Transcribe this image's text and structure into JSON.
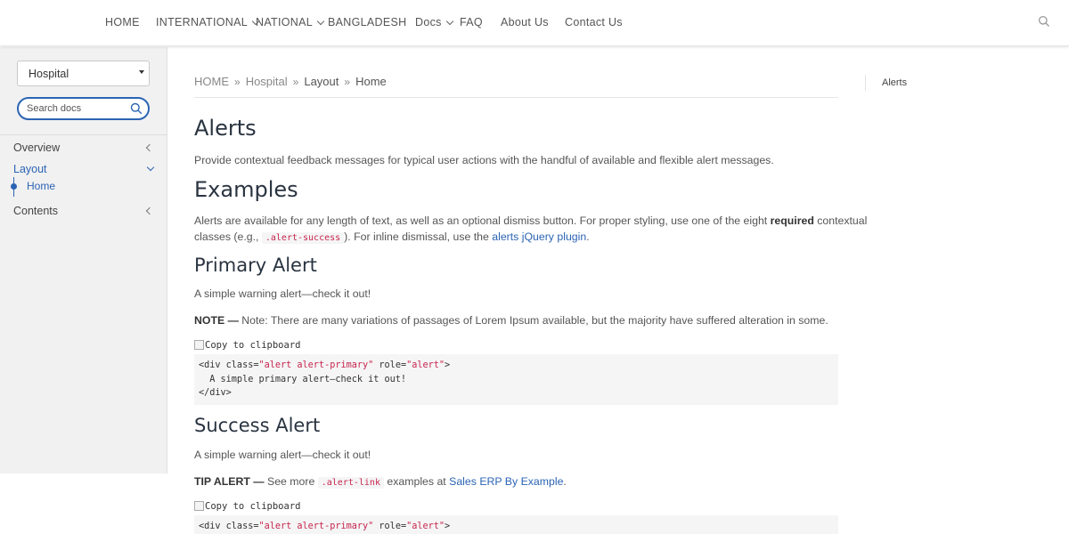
{
  "nav": {
    "items": [
      {
        "label": "HOME",
        "dropdown": false
      },
      {
        "label": "INTERNATIONAL",
        "dropdown": true
      },
      {
        "label": "NATIONAL",
        "dropdown": true
      },
      {
        "label": "BANGLADESH",
        "dropdown": false
      },
      {
        "label": "Docs",
        "dropdown": true
      },
      {
        "label": "FAQ",
        "dropdown": false
      },
      {
        "label": "About Us",
        "dropdown": false
      },
      {
        "label": "Contact Us",
        "dropdown": false
      }
    ],
    "search_icon": "search-icon"
  },
  "sidebar": {
    "select_value": "Hospital",
    "search_placeholder": "Search docs",
    "items": [
      {
        "label": "Overview",
        "expanded": false
      },
      {
        "label": "Layout",
        "expanded": true,
        "active": true
      },
      {
        "label": "Contents",
        "expanded": false
      }
    ],
    "sub_item": "Home"
  },
  "breadcrumb": {
    "items": [
      "HOME",
      "Hospital",
      "Layout",
      "Home"
    ],
    "separator": "»"
  },
  "content": {
    "title": "Alerts",
    "intro": "Provide contextual feedback messages for typical user actions with the handful of available and flexible alert messages.",
    "examples_heading": "Examples",
    "examples_text_1": "Alerts are available for any length of text, as well as an optional dismiss button. For proper styling, use one of the eight",
    "examples_bold": "required",
    "examples_text_2": "contextual",
    "examples_text_3": "classes (e.g.,",
    "examples_code": ".alert-success",
    "examples_text_4": "). For inline dismissal, use the",
    "examples_link": "alerts jQuery plugin",
    "examples_text_5": ".",
    "primary_heading": "Primary Alert",
    "primary_text": "A simple warning alert—check it out!",
    "note_label": "NOTE —",
    "note_text": "Note: There are many variations of passages of Lorem Ipsum available, but the majority have suffered alteration in some.",
    "copy_label": "Copy to clipboard",
    "code_line1_a": "<div class=",
    "code_line1_b": "\"alert alert-primary\"",
    "code_line1_c": " role=",
    "code_line1_d": "\"alert\"",
    "code_line1_e": ">",
    "code_line2": "  A simple primary alert—check it out!",
    "code_line3": "</div>",
    "success_heading": "Success Alert",
    "success_text": "A simple warning alert—check it out!",
    "tip_label": "TIP ALERT —",
    "tip_text_1": "See more",
    "tip_code": ".alert-link",
    "tip_text_2": "examples at",
    "tip_link": "Sales ERP By Example",
    "tip_text_3": "."
  },
  "toc": {
    "item": "Alerts"
  },
  "colors": {
    "accent": "#2b64b4",
    "code_string": "#c7254e",
    "heading": "#2a3441"
  }
}
